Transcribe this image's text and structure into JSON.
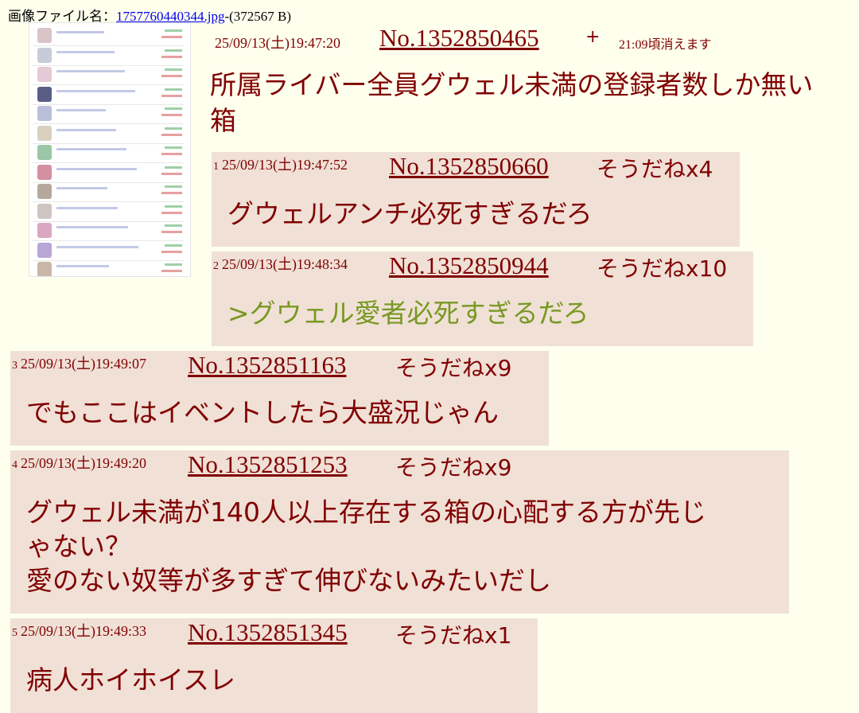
{
  "file_info": {
    "label": "画像ファイル名：",
    "filename": "1757760440344.jpg",
    "size": "-(372567 B)"
  },
  "op": {
    "date": "25/09/13(土)19:47:20",
    "number": "No.1352850465",
    "plus": "+",
    "expire": "21:09頃消えます",
    "text": "所属ライバー全員グウェル未満の登録者数しか無い箱"
  },
  "replies": [
    {
      "index": "1",
      "date": "25/09/13(土)19:47:52",
      "number": "No.1352850660",
      "sodane": "そうだねx4",
      "lines": [
        {
          "text": "グウェルアンチ必死すぎるだろ",
          "quote": false
        }
      ]
    },
    {
      "index": "2",
      "date": "25/09/13(土)19:48:34",
      "number": "No.1352850944",
      "sodane": "そうだねx10",
      "lines": [
        {
          "text": ">グウェル愛者必死すぎるだろ",
          "quote": true
        }
      ]
    },
    {
      "index": "3",
      "date": "25/09/13(土)19:49:07",
      "number": "No.1352851163",
      "sodane": "そうだねx9",
      "lines": [
        {
          "text": "でもここはイベントしたら大盛況じゃん",
          "quote": false
        }
      ]
    },
    {
      "index": "4",
      "date": "25/09/13(土)19:49:20",
      "number": "No.1352851253",
      "sodane": "そうだねx9",
      "lines": [
        {
          "text": "グウェル未満が140人以上存在する箱の心配する方が先じ",
          "quote": false
        },
        {
          "text": "ゃない？",
          "quote": false
        },
        {
          "text": "愛のない奴等が多すぎて伸びないみたいだし",
          "quote": false
        }
      ]
    },
    {
      "index": "5",
      "date": "25/09/13(土)19:49:33",
      "number": "No.1352851345",
      "sodane": "そうだねx1",
      "lines": [
        {
          "text": "病人ホイホイスレ",
          "quote": false
        }
      ]
    }
  ],
  "colors": {
    "background": "#ffffee",
    "reply_background": "#f0e0d6",
    "text": "#800000",
    "quote": "#789922",
    "link": "#0000ee"
  }
}
